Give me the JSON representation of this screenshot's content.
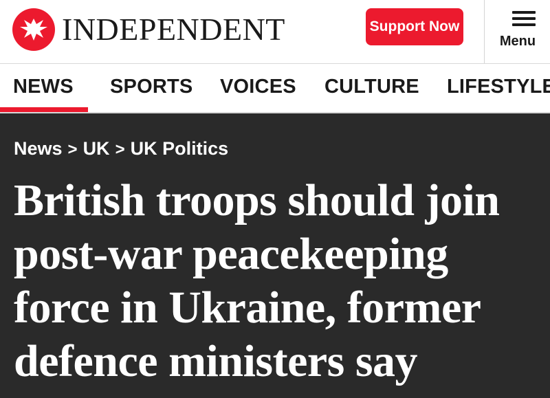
{
  "header": {
    "logo_text": "INDEPENDENT",
    "logo_icon": "eagle-icon",
    "support_label": "Support Now",
    "menu_label": "Menu"
  },
  "nav": {
    "items": [
      {
        "label": "NEWS",
        "active": true
      },
      {
        "label": "SPORTS"
      },
      {
        "label": "VOICES"
      },
      {
        "label": "CULTURE"
      },
      {
        "label": "LIFESTYLE"
      }
    ]
  },
  "breadcrumb": {
    "items": [
      "News",
      "UK",
      "UK Politics"
    ],
    "separator": ">"
  },
  "article": {
    "headline": "British troops should join post-war peacekeeping force in Ukraine, former defence ministers say"
  },
  "colors": {
    "brand_red": "#ec1a2e",
    "hero_bg": "#2a2a2a",
    "text_dark": "#1a1a1a"
  }
}
